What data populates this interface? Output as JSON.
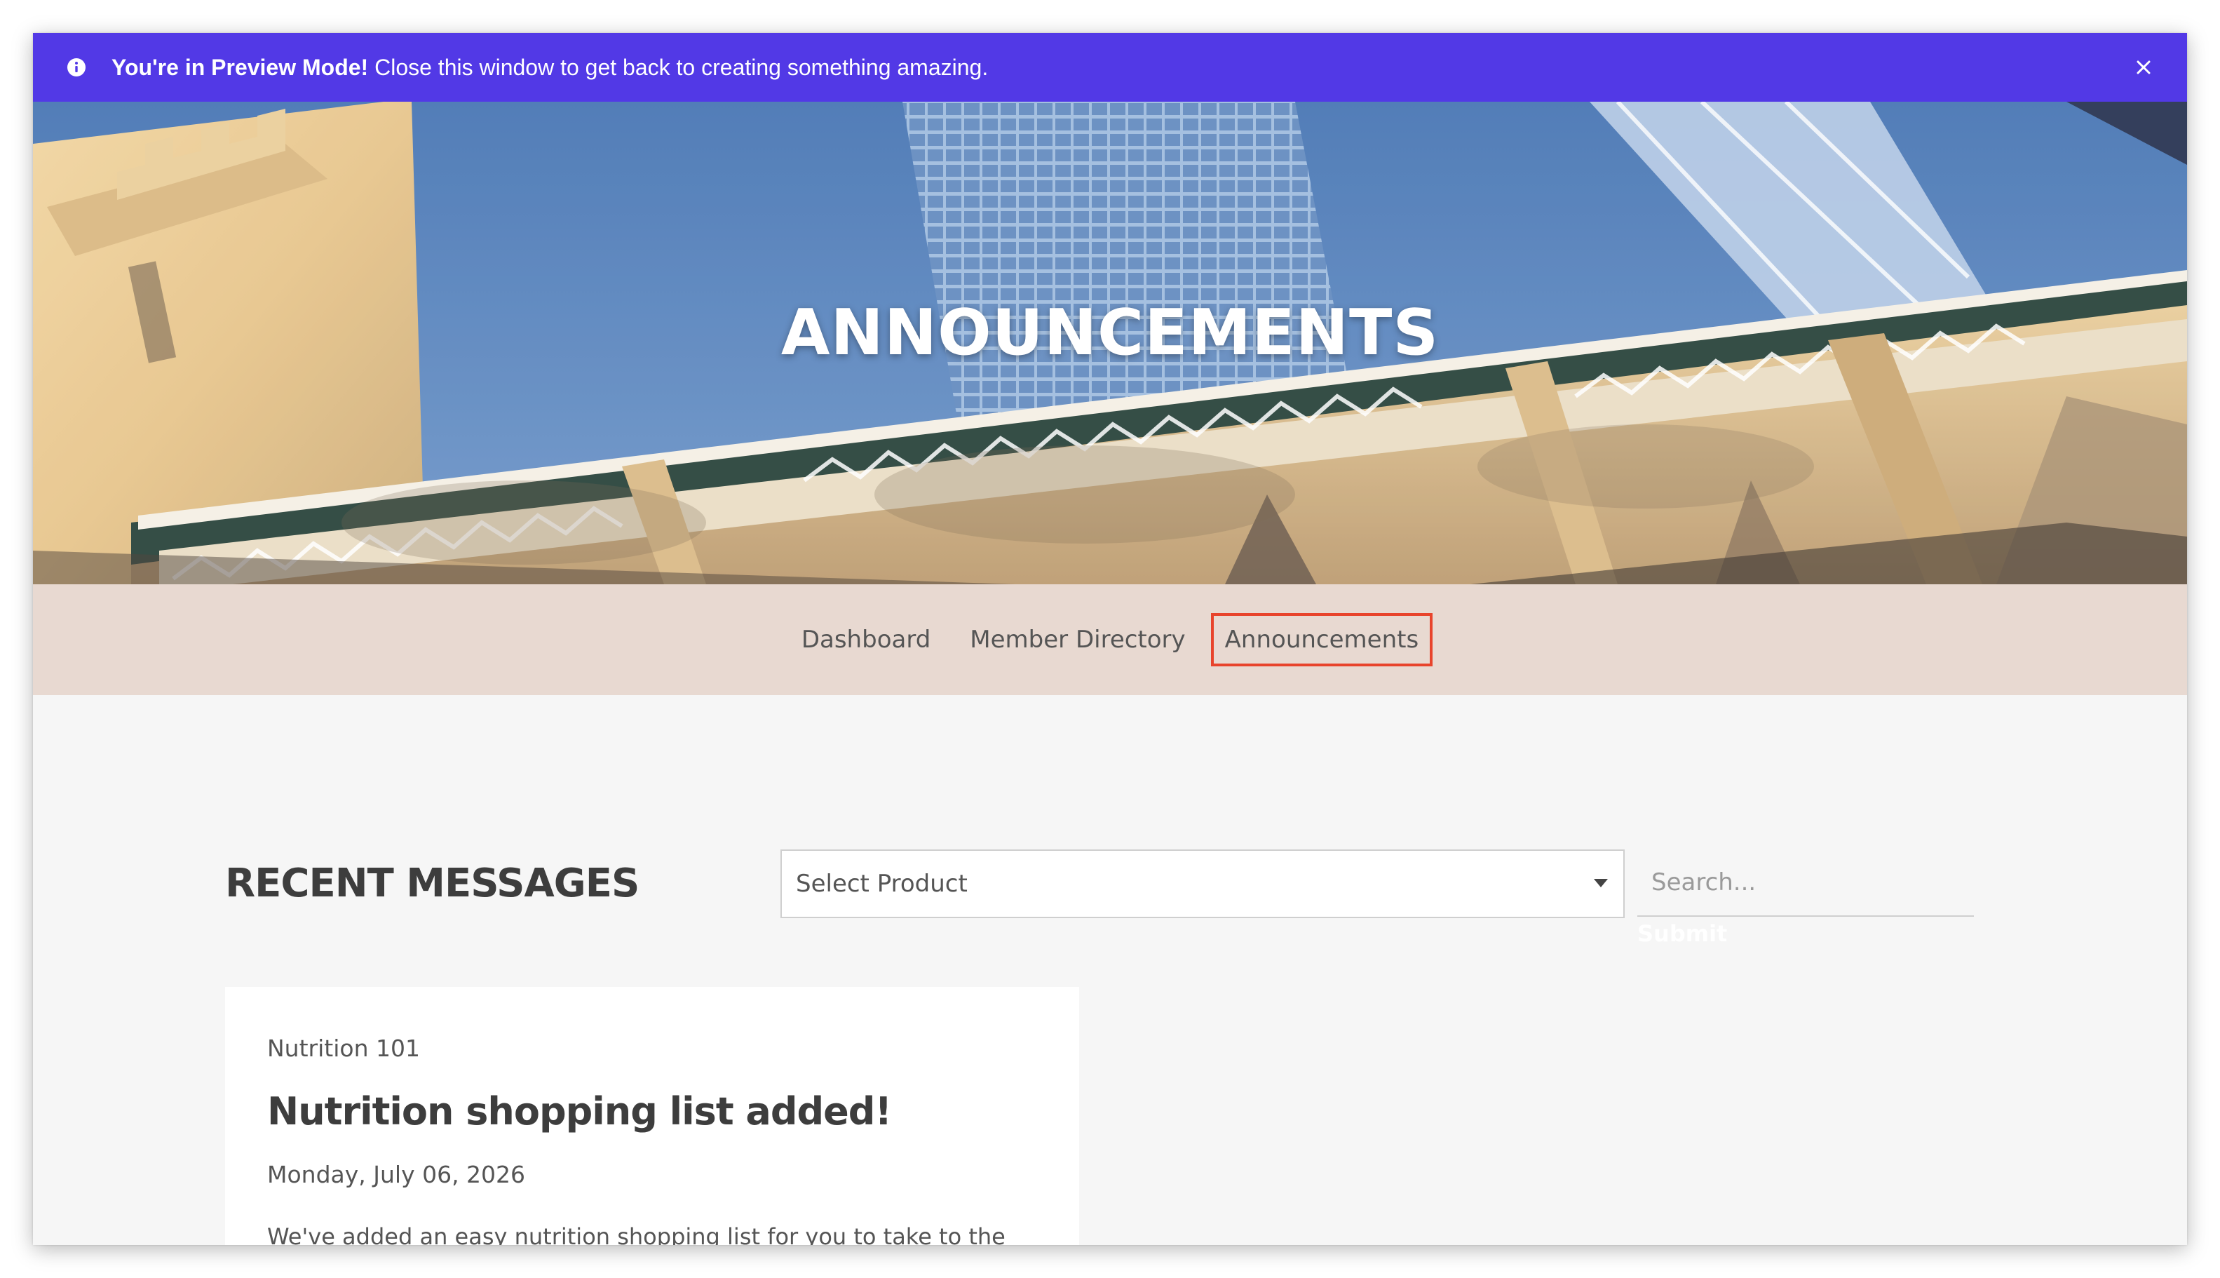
{
  "preview_banner": {
    "bold_text": "You're in Preview Mode!",
    "text": "Close this window to get back to creating something amazing.",
    "info_icon": "info-icon",
    "close_icon": "close-icon",
    "color": "#5239e6"
  },
  "hero": {
    "title": "ANNOUNCEMENTS"
  },
  "nav": {
    "items": [
      {
        "label": "Dashboard"
      },
      {
        "label": "Member Directory"
      },
      {
        "label": "Announcements"
      }
    ],
    "active_index": 2,
    "active_outline_color": "#e8442c",
    "background": "#e8d9d1"
  },
  "main": {
    "section_title": "RECENT MESSAGES",
    "product_select": {
      "selected": "Select Product"
    },
    "search": {
      "placeholder": "Search...",
      "submit_label": "Submit"
    },
    "messages": [
      {
        "category": "Nutrition 101",
        "title": "Nutrition shopping list added!",
        "date": "Monday, July 06, 2026",
        "excerpt": "We've added an easy nutrition shopping list for you to take to the"
      }
    ]
  }
}
